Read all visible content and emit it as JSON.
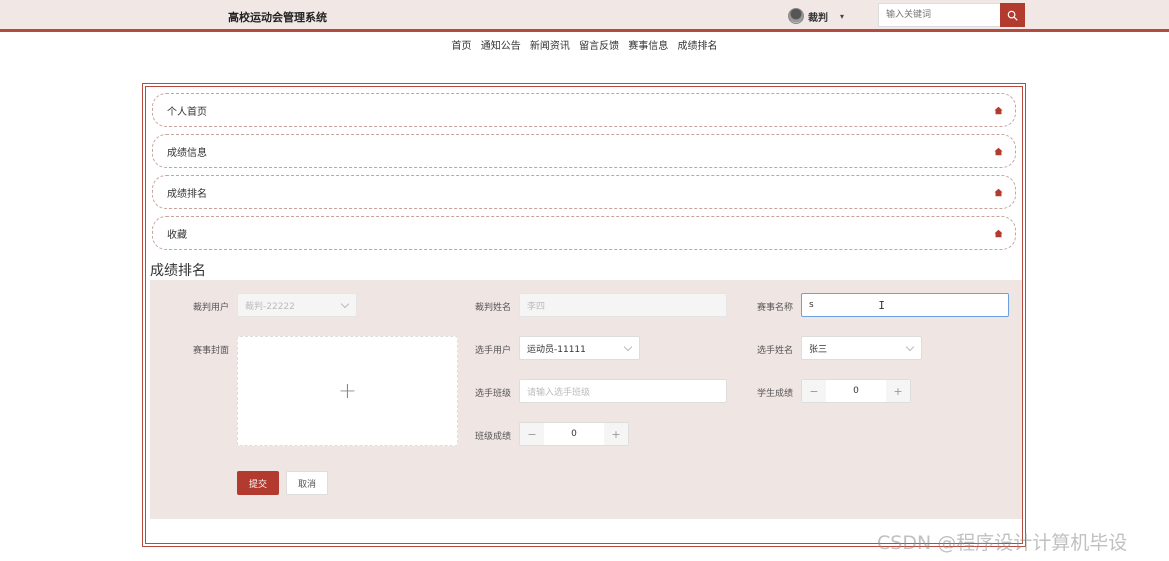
{
  "header": {
    "site_title": "高校运动会管理系统",
    "user_name": "裁判",
    "caret": "▾",
    "search_placeholder": "输入关键词"
  },
  "nav": [
    "首页",
    "通知公告",
    "新闻资讯",
    "留言反馈",
    "赛事信息",
    "成绩排名"
  ],
  "menu": [
    "个人首页",
    "成绩信息",
    "成绩排名",
    "收藏"
  ],
  "section_title": "成绩排名",
  "form": {
    "referee_user_label": "裁判用户",
    "referee_user_value": "裁判-22222",
    "referee_name_label": "裁判姓名",
    "referee_name_value": "李四",
    "event_name_label": "赛事名称",
    "event_name_value": "s",
    "event_cover_label": "赛事封面",
    "player_user_label": "选手用户",
    "player_user_value": "运动员-11111",
    "player_name_label": "选手姓名",
    "player_name_value": "张三",
    "player_class_label": "选手班级",
    "player_class_placeholder": "请输入选手班级",
    "student_score_label": "学生成绩",
    "student_score_value": "0",
    "class_score_label": "班级成绩",
    "class_score_value": "0",
    "minus": "−",
    "plus": "+",
    "upload_plus": "+",
    "submit_label": "提交",
    "cancel_label": "取消"
  },
  "watermark": "CSDN @程序设计计算机毕设",
  "colors": {
    "accent": "#b23a2e",
    "header_bg": "#f1e8e6",
    "panel_bg": "#efe5e3"
  }
}
